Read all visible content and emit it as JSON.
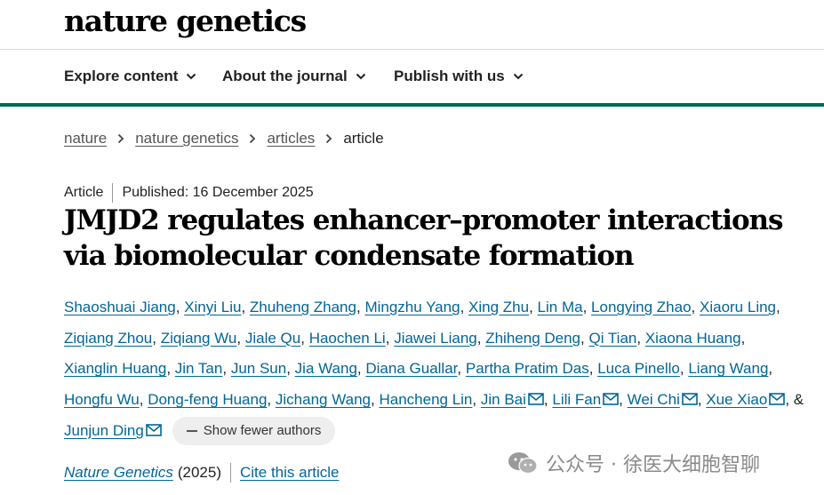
{
  "site": {
    "logo": "nature genetics"
  },
  "nav": {
    "items": [
      {
        "label": "Explore content"
      },
      {
        "label": "About the journal"
      },
      {
        "label": "Publish with us"
      }
    ]
  },
  "breadcrumb": {
    "items": [
      {
        "label": "nature"
      },
      {
        "label": "nature genetics"
      },
      {
        "label": "articles"
      }
    ],
    "current": "article"
  },
  "article": {
    "type": "Article",
    "published": "Published: 16 December 2025",
    "title": "JMJD2 regulates enhancer–promoter interactions via biomolecular condensate formation"
  },
  "authors": {
    "list": [
      "Shaoshuai Jiang",
      "Xinyi Liu",
      "Zhuheng Zhang",
      "Mingzhu Yang",
      "Xing Zhu",
      "Lin Ma",
      "Longying Zhao",
      "Xiaoru Ling",
      "Ziqiang Zhou",
      "Ziqiang Wu",
      "Jiale Qu",
      "Haochen Li",
      "Jiawei Liang",
      "Zhiheng Deng",
      "Qi Tian",
      "Xiaona Huang",
      "Xianglin Huang",
      "Jin Tan",
      "Jun Sun",
      "Jia Wang",
      "Diana Guallar",
      "Partha Pratim Das",
      "Luca Pinello",
      "Liang Wang",
      "Hongfu Wu",
      "Dong-feng Huang",
      "Jichang Wang",
      "Hancheng Lin",
      "Jin Bai",
      "Lili Fan",
      "Wei Chi",
      "Xue Xiao"
    ],
    "corresponding": [
      "Jin Bai",
      "Lili Fan",
      "Wei Chi",
      "Xue Xiao",
      "Junjun Ding"
    ],
    "conjunction": "&",
    "last": "Junjun Ding",
    "toggle_label": "Show fewer authors"
  },
  "citation": {
    "journal": "Nature Genetics",
    "year": "(2025)",
    "cite_label": "Cite this article"
  },
  "watermark": {
    "text": "公众号 · 徐医大细胞智聊"
  },
  "colors": {
    "accent": "#00685a",
    "link": "#006699"
  }
}
